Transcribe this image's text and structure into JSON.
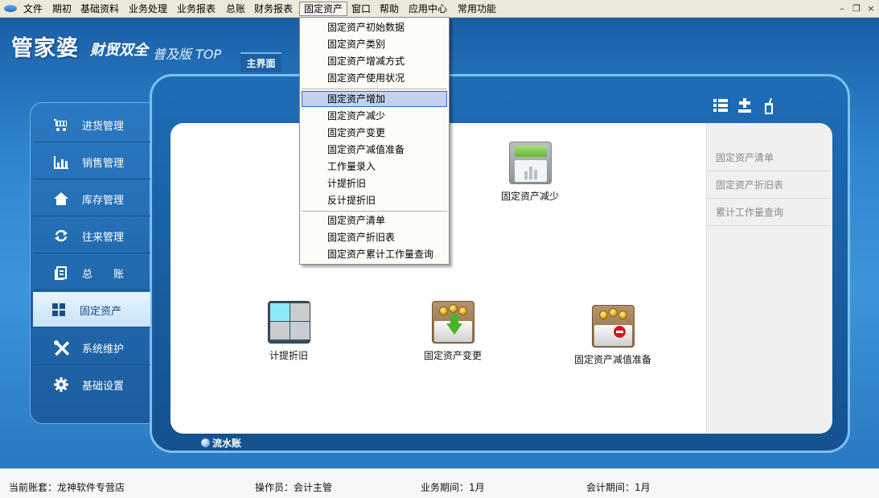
{
  "menubar": {
    "items": [
      "文件",
      "期初",
      "基础资料",
      "业务处理",
      "业务报表",
      "总账",
      "财务报表",
      "固定资产",
      "窗口",
      "帮助",
      "应用中心",
      "常用功能"
    ],
    "active_index": 7,
    "window_controls": [
      "–",
      "❐",
      "×"
    ]
  },
  "brand": {
    "name": "管家婆",
    "product": "财贸双全",
    "edition": "普及版 TOP"
  },
  "home_tab": "主界面",
  "sidebar": {
    "items": [
      {
        "label": "进货管理",
        "icon": "cart-icon"
      },
      {
        "label": "销售管理",
        "icon": "chart-icon"
      },
      {
        "label": "库存管理",
        "icon": "house-icon"
      },
      {
        "label": "往来管理",
        "icon": "refresh-icon"
      },
      {
        "label": "总　　账",
        "icon": "ledger-icon"
      },
      {
        "label": "固定资产",
        "icon": "grid-icon"
      },
      {
        "label": "系统维护",
        "icon": "tools-icon"
      },
      {
        "label": "基础设置",
        "icon": "gear-icon"
      }
    ],
    "active_index": 5
  },
  "toolbar_icons": [
    "list-icon",
    "plus-minus-icon",
    "drink-icon"
  ],
  "features": [
    {
      "label": "固定资产减少",
      "icon": "chart-doc-icon"
    },
    {
      "label": "计提折旧",
      "icon": "grid-tiles-icon"
    },
    {
      "label": "固定资产变更",
      "icon": "coins-down-icon"
    },
    {
      "label": "固定资产减值准备",
      "icon": "coins-minus-icon"
    }
  ],
  "right_panel": {
    "links": [
      "固定资产清单",
      "固定资产折旧表",
      "累计工作量查询"
    ]
  },
  "bottom_label": "流水账",
  "dropdown": {
    "groups": [
      [
        "固定资产初始数据",
        "固定资产类别",
        "固定资产增减方式",
        "固定资产使用状况"
      ],
      [
        "固定资产增加",
        "固定资产减少",
        "固定资产变更",
        "固定资产减值准备",
        "工作量录入",
        "计提折旧",
        "反计提折旧"
      ],
      [
        "固定资产清单",
        "固定资产折旧表",
        "固定资产累计工作量查询"
      ]
    ],
    "highlighted": "固定资产增加"
  },
  "statusbar": {
    "account": "当前账套：龙神软件专营店",
    "operator": "操作员：会计主管",
    "business_period": "业务期间：1月",
    "accounting_period": "会计期间：1月"
  },
  "colors": {
    "background_blue": "#2f86cf",
    "menu_highlight": "#c1d2ee",
    "sidebar_active": "#dff0fc"
  }
}
